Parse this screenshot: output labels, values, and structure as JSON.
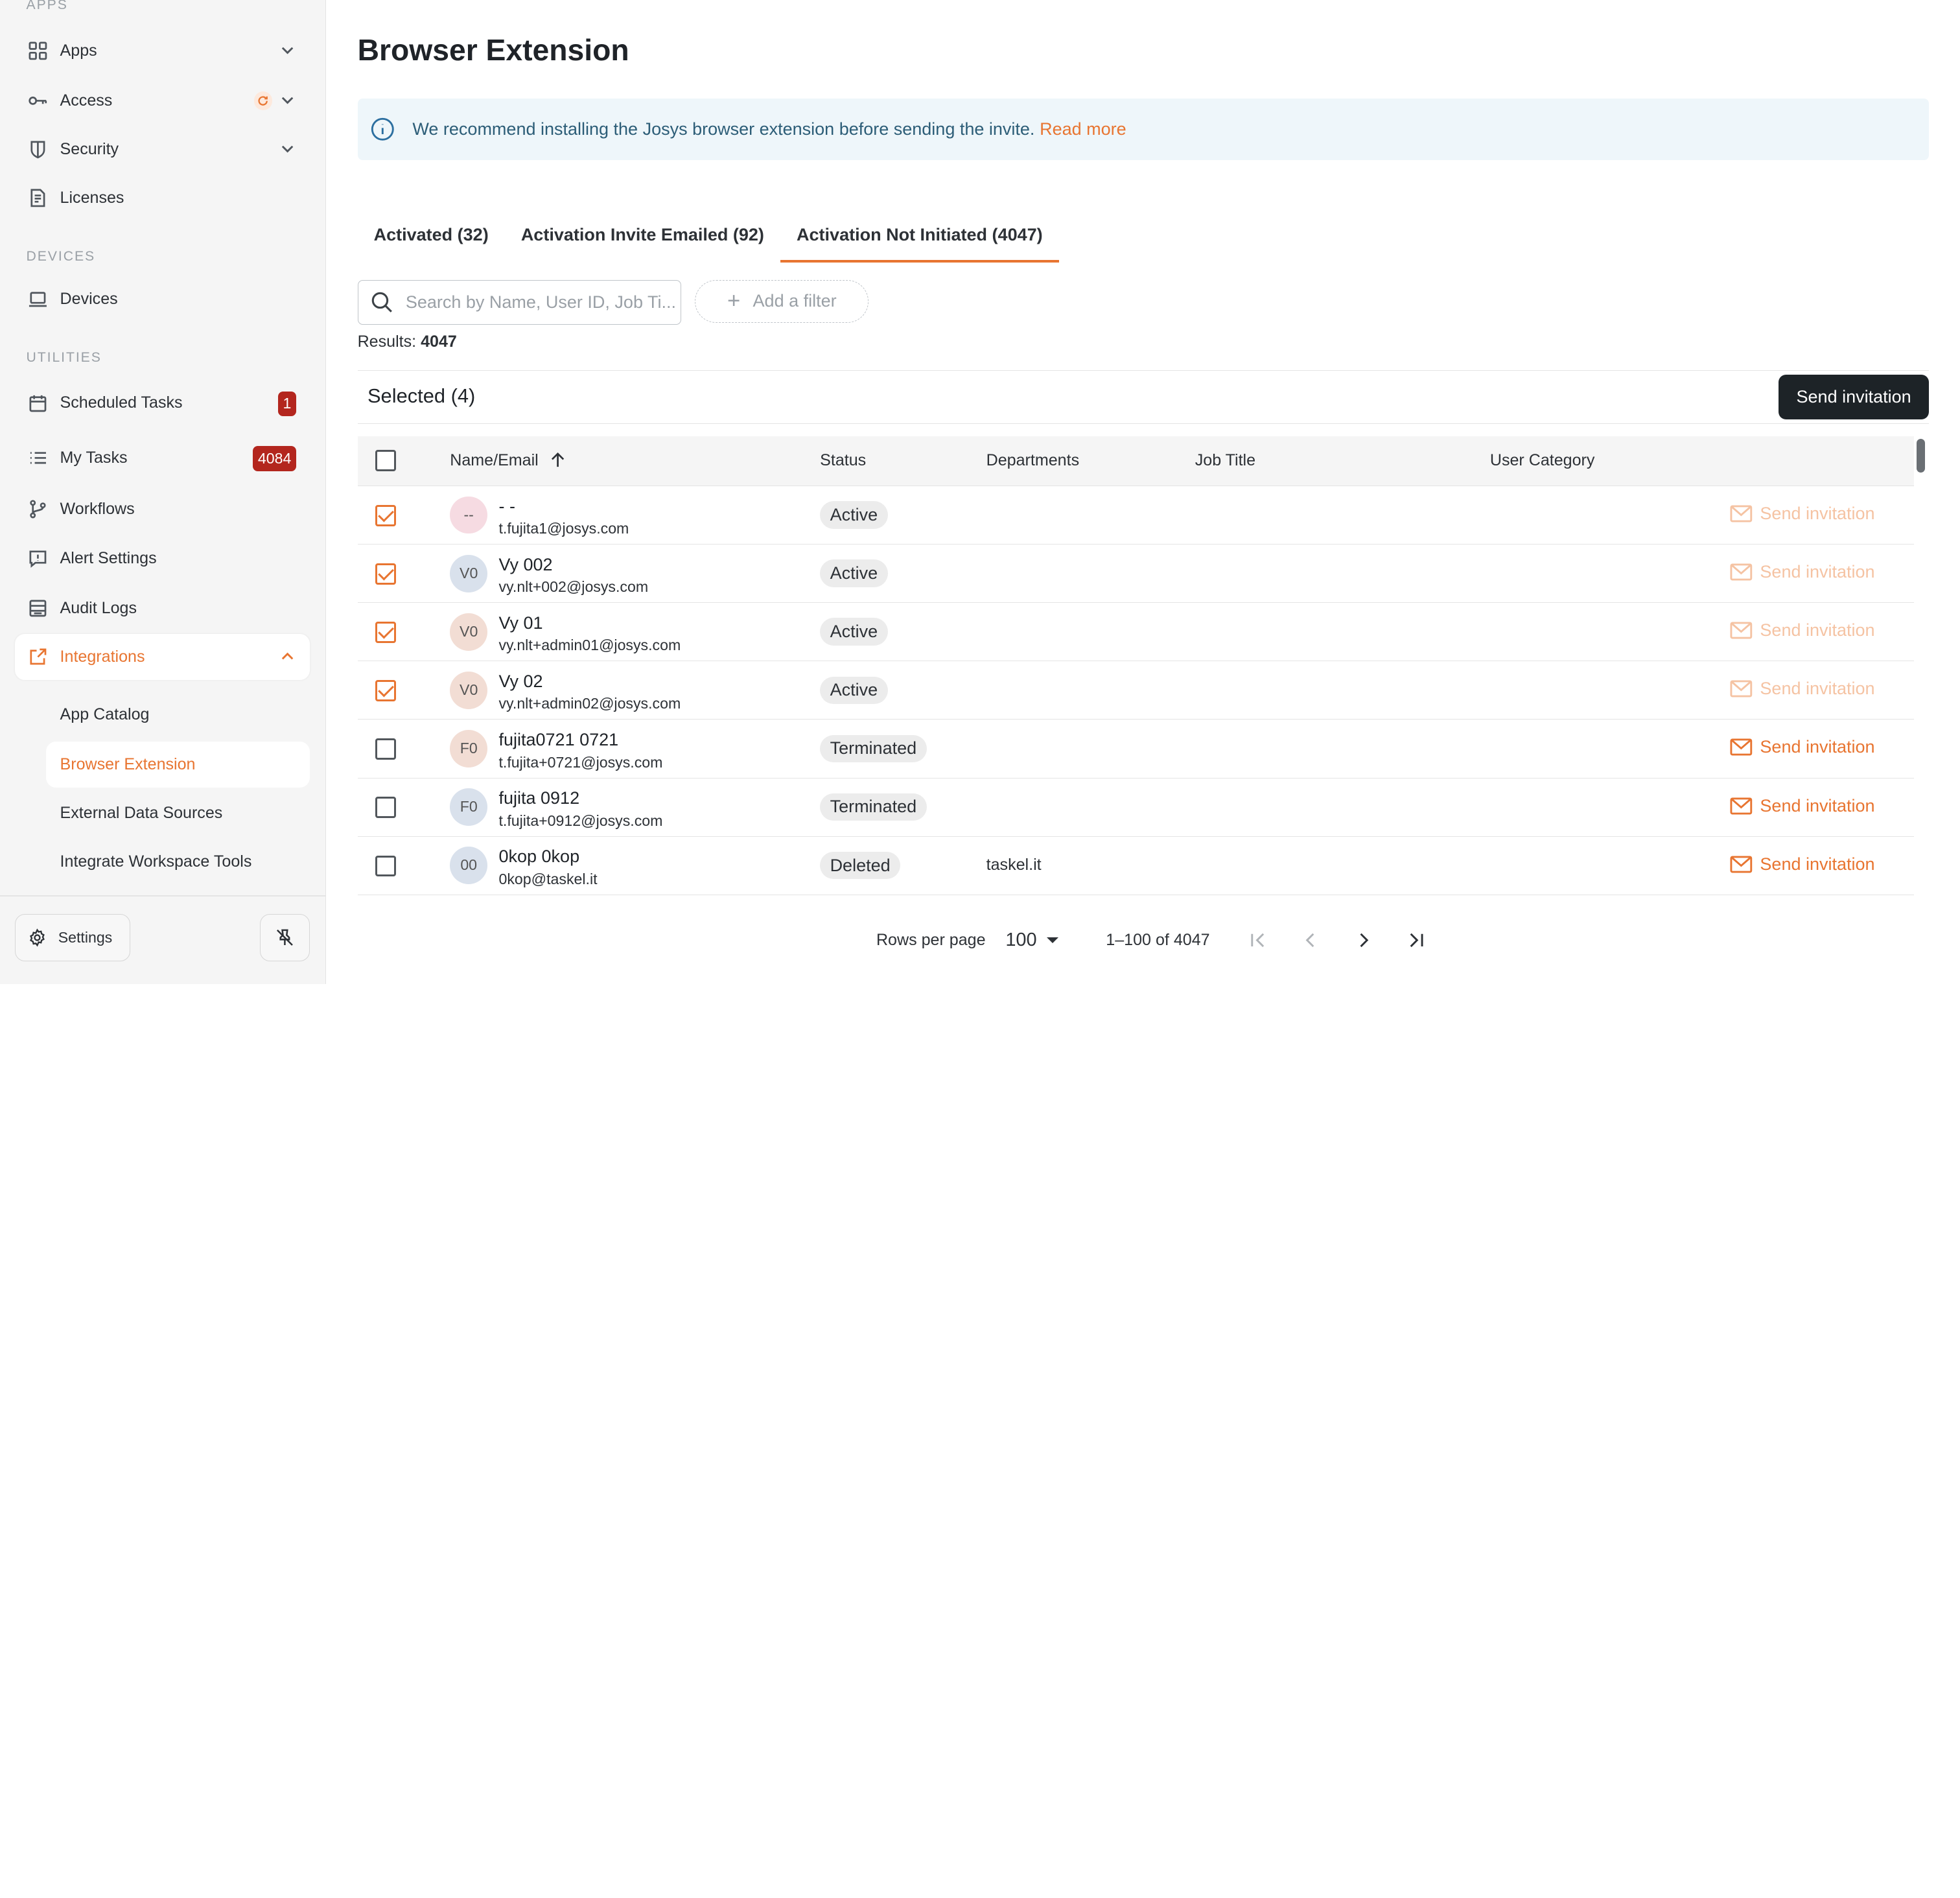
{
  "sidebar": {
    "sections": {
      "apps": "APPS",
      "devices": "DEVICES",
      "utilities": "UTILITIES"
    },
    "items": {
      "apps": "Apps",
      "access": "Access",
      "security": "Security",
      "licenses": "Licenses",
      "devices": "Devices",
      "scheduled_tasks": "Scheduled Tasks",
      "scheduled_tasks_badge": "1",
      "my_tasks": "My Tasks",
      "my_tasks_badge": "4084",
      "workflows": "Workflows",
      "alert_settings": "Alert Settings",
      "audit_logs": "Audit Logs",
      "integrations": "Integrations"
    },
    "sub_items": {
      "app_catalog": "App Catalog",
      "browser_extension": "Browser Extension",
      "external_data_sources": "External Data Sources",
      "integrate_workspace_tools": "Integrate Workspace Tools"
    },
    "settings_label": "Settings",
    "accent_color": "#e87531"
  },
  "page": {
    "title": "Browser Extension",
    "banner_text": "We recommend installing the Josys browser extension before sending the invite.",
    "banner_link": "Read more"
  },
  "tabs": [
    {
      "label": "Activated (32)"
    },
    {
      "label": "Activation Invite Emailed (92)"
    },
    {
      "label": "Activation Not Initiated (4047)"
    }
  ],
  "toolbar": {
    "search_placeholder": "Search by Name, User ID, Job Ti...",
    "add_filter": "Add a filter",
    "results_label": "Results:",
    "results_count": "4047",
    "selected_label": "Selected (4)",
    "send_button": "Send invitation"
  },
  "table": {
    "columns": {
      "name": "Name/Email",
      "status": "Status",
      "departments": "Departments",
      "job_title": "Job Title",
      "user_category": "User Category"
    },
    "action_label": "Send invitation",
    "rows": [
      {
        "initials": "--",
        "name": "- -",
        "email": "t.fujita1@josys.com",
        "status": "Active",
        "department": "",
        "checked": true,
        "avatar_color": "#f6dbe2"
      },
      {
        "initials": "V0",
        "name": "Vy 002",
        "email": "vy.nlt+002@josys.com",
        "status": "Active",
        "department": "",
        "checked": true,
        "avatar_color": "#d9e1ec"
      },
      {
        "initials": "V0",
        "name": "Vy 01",
        "email": "vy.nlt+admin01@josys.com",
        "status": "Active",
        "department": "",
        "checked": true,
        "avatar_color": "#f2ddd4"
      },
      {
        "initials": "V0",
        "name": "Vy 02",
        "email": "vy.nlt+admin02@josys.com",
        "status": "Active",
        "department": "",
        "checked": true,
        "avatar_color": "#f2ddd4"
      },
      {
        "initials": "F0",
        "name": "fujita0721 0721",
        "email": "t.fujita+0721@josys.com",
        "status": "Terminated",
        "department": "",
        "checked": false,
        "avatar_color": "#f2ddd4"
      },
      {
        "initials": "F0",
        "name": "fujita 0912",
        "email": "t.fujita+0912@josys.com",
        "status": "Terminated",
        "department": "",
        "checked": false,
        "avatar_color": "#d9e1ec"
      },
      {
        "initials": "00",
        "name": "0kop 0kop",
        "email": "0kop@taskel.it",
        "status": "Deleted",
        "department": "taskel.it",
        "checked": false,
        "avatar_color": "#d9e1ec"
      }
    ]
  },
  "pagination": {
    "rows_per_page_label": "Rows per page",
    "rows_per_page": "100",
    "range": "1–100 of 4047"
  }
}
